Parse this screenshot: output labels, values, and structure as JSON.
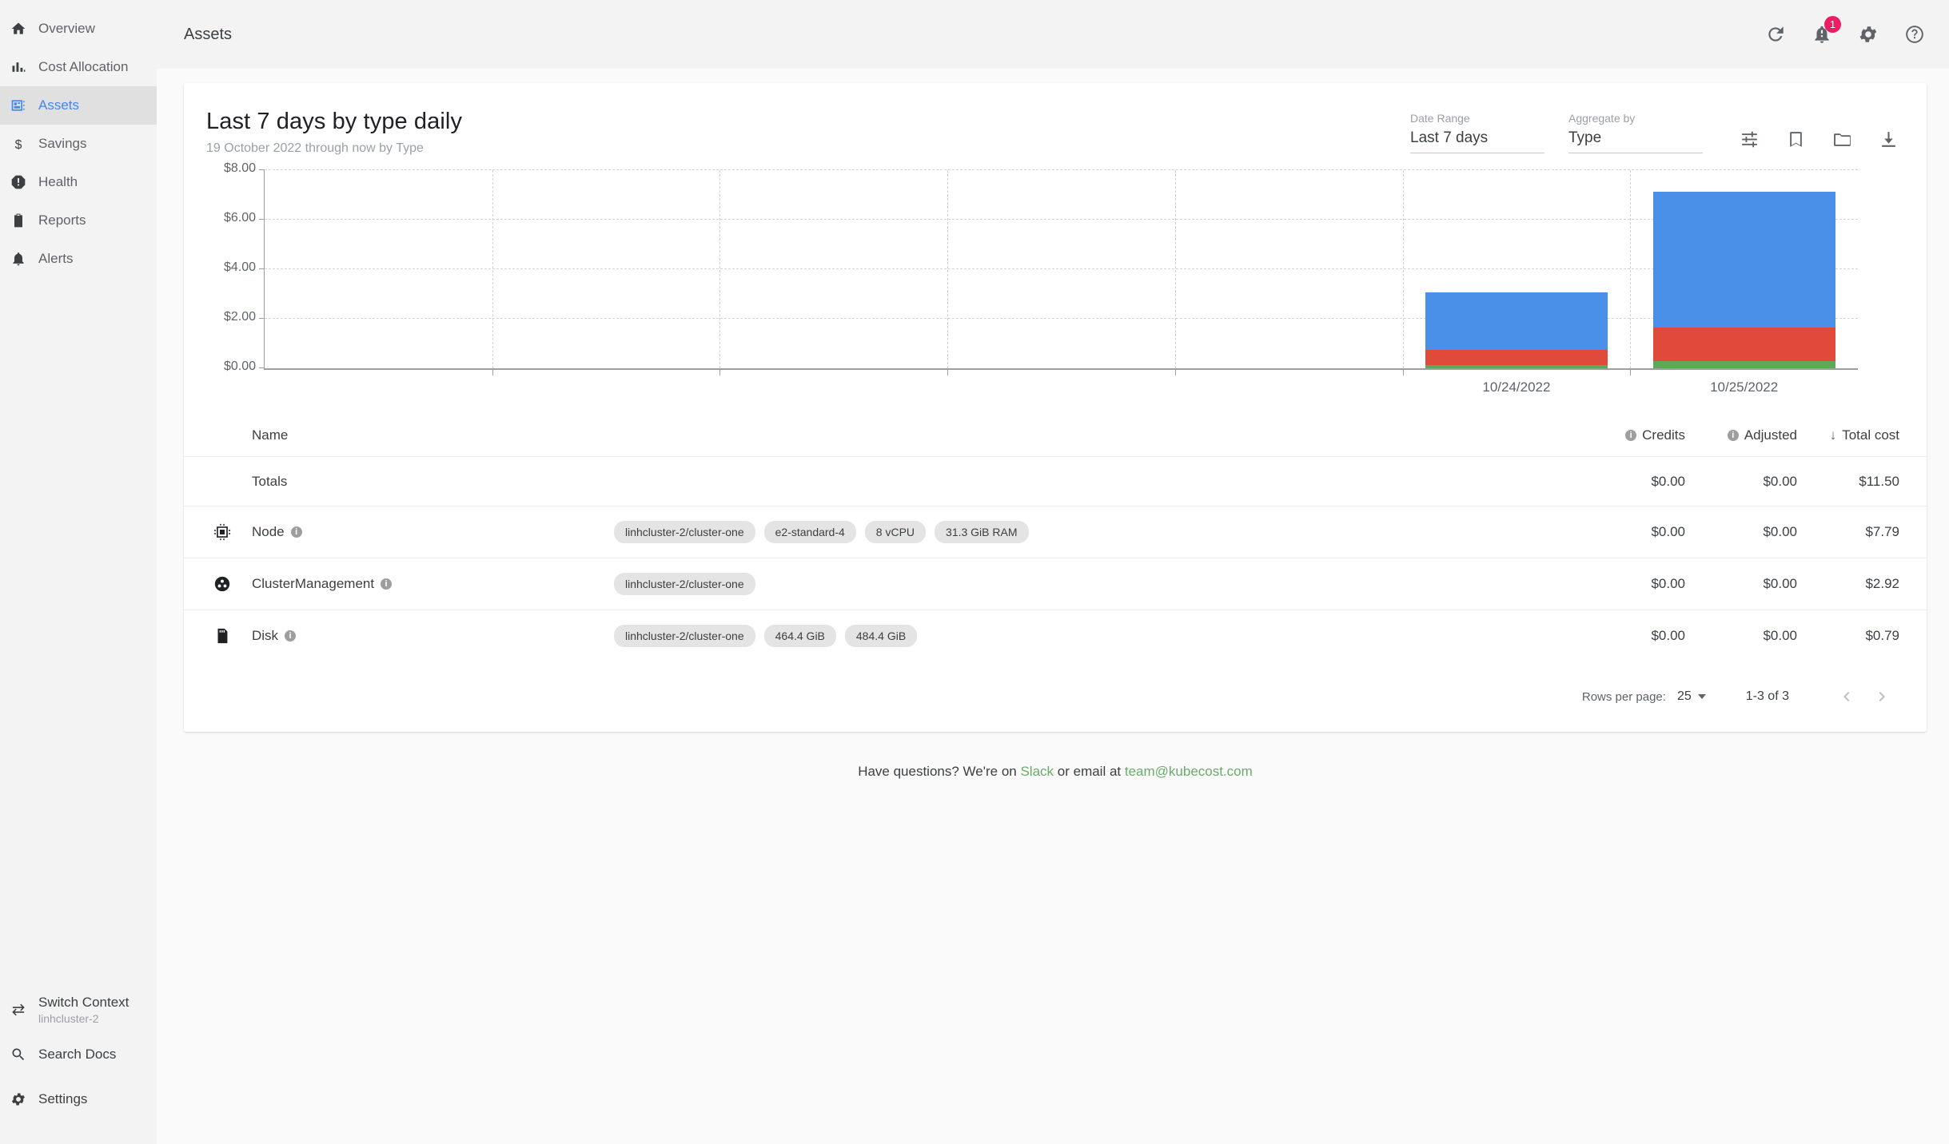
{
  "sidebar": {
    "items": [
      {
        "label": "Overview",
        "icon": "home-icon",
        "active": false
      },
      {
        "label": "Cost Allocation",
        "icon": "bar-chart-icon",
        "active": false
      },
      {
        "label": "Assets",
        "icon": "assets-icon",
        "active": true
      },
      {
        "label": "Savings",
        "icon": "dollar-icon",
        "active": false
      },
      {
        "label": "Health",
        "icon": "health-alert-icon",
        "active": false
      },
      {
        "label": "Reports",
        "icon": "clipboard-icon",
        "active": false
      },
      {
        "label": "Alerts",
        "icon": "bell-icon",
        "active": false
      }
    ],
    "bottom": {
      "switch_context_label": "Switch Context",
      "switch_context_value": "linhcluster-2",
      "search_docs_label": "Search Docs",
      "settings_label": "Settings"
    }
  },
  "topbar": {
    "breadcrumb": "Assets",
    "notification_count": "1",
    "icons": [
      "refresh-icon",
      "notifications-icon",
      "settings-gear-icon",
      "help-icon"
    ]
  },
  "report": {
    "title": "Last 7 days by type daily",
    "subtitle": "19 October 2022 through now by Type",
    "date_range_label": "Date Range",
    "date_range_value": "Last 7 days",
    "aggregate_label": "Aggregate by",
    "aggregate_value": "Type",
    "action_icons": [
      "filter-settings-icon",
      "bookmark-icon",
      "folder-icon",
      "download-icon"
    ]
  },
  "chart_data": {
    "type": "bar",
    "stacked": true,
    "title": "Last 7 days by type daily",
    "xlabel": "",
    "ylabel": "",
    "ylim": [
      0,
      8
    ],
    "ytick_labels": [
      "$0.00",
      "$2.00",
      "$4.00",
      "$6.00",
      "$8.00"
    ],
    "ytick_values": [
      0,
      2,
      4,
      6,
      8
    ],
    "grid": true,
    "legend": "none",
    "x_slots": 7,
    "categories": [
      "",
      "",
      "",
      "",
      "",
      "10/24/2022",
      "10/25/2022"
    ],
    "series": [
      {
        "name": "Disk",
        "color": "#5fa85a",
        "values": [
          0,
          0,
          0,
          0,
          0,
          0.13,
          0.3
        ]
      },
      {
        "name": "ClusterManagement",
        "color": "#e04a3a",
        "values": [
          0,
          0,
          0,
          0,
          0,
          0.62,
          1.33
        ]
      },
      {
        "name": "Node",
        "color": "#4a90e8",
        "values": [
          0,
          0,
          0,
          0,
          0,
          2.3,
          5.49
        ]
      }
    ],
    "bar_totals": [
      0,
      0,
      0,
      0,
      0,
      3.05,
      7.12
    ]
  },
  "table": {
    "columns": {
      "name": "Name",
      "credits": "Credits",
      "adjusted": "Adjusted",
      "total_cost": "Total cost",
      "sort_arrow": "↓"
    },
    "totals": {
      "name": "Totals",
      "credits": "$0.00",
      "adjusted": "$0.00",
      "total_cost": "$11.50"
    },
    "rows": [
      {
        "icon": "cpu-chip-icon",
        "name": "Node",
        "chips": [
          "linhcluster-2/cluster-one",
          "e2-standard-4",
          "8 vCPU",
          "31.3 GiB RAM"
        ],
        "credits": "$0.00",
        "adjusted": "$0.00",
        "total_cost": "$7.79"
      },
      {
        "icon": "cluster-nodes-icon",
        "name": "ClusterManagement",
        "chips": [
          "linhcluster-2/cluster-one"
        ],
        "credits": "$0.00",
        "adjusted": "$0.00",
        "total_cost": "$2.92"
      },
      {
        "icon": "disk-icon",
        "name": "Disk",
        "chips": [
          "linhcluster-2/cluster-one",
          "464.4 GiB",
          "484.4 GiB"
        ],
        "credits": "$0.00",
        "adjusted": "$0.00",
        "total_cost": "$0.79"
      }
    ],
    "pager": {
      "rows_per_page_label": "Rows per page:",
      "rows_per_page_value": "25",
      "range": "1-3 of 3"
    }
  },
  "footer": {
    "text_before": "Have questions? We're on ",
    "slack_link": "Slack",
    "text_middle": " or email at ",
    "email_link": "team@kubecost.com"
  },
  "colors": {
    "accent": "#4285f4",
    "badge": "#e91e63",
    "link_green": "#6aab6a",
    "bar_blue": "#4a90e8",
    "bar_red": "#e04a3a",
    "bar_green": "#5fa85a"
  }
}
